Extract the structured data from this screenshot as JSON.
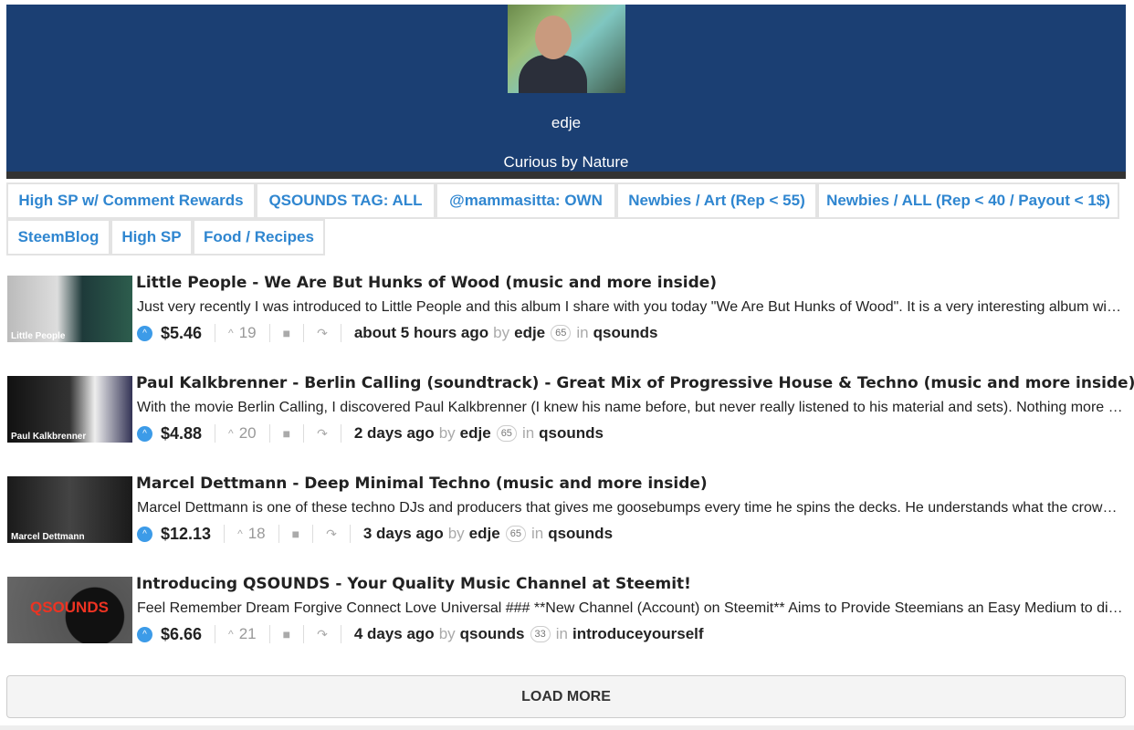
{
  "profile": {
    "name": "edje",
    "bio": "Curious by Nature"
  },
  "tabs": [
    "High SP w/ Comment Rewards",
    "QSOUNDS TAG: ALL",
    "@mammasitta: OWN",
    "Newbies / Art (Rep < 55)",
    "Newbies / ALL (Rep < 40 / Payout < 1$)",
    "SteemBlog",
    "High SP",
    "Food / Recipes"
  ],
  "posts": [
    {
      "thumb_text": "Little People",
      "title": "Little People - We Are But Hunks of Wood (music and more inside)",
      "body": "Just very recently I was introduced to Little People and this album I share with you today \"We Are But Hunks of Wood\". It is a very interesting album with a lot of variety.",
      "payout": "$5.46",
      "votes": "19",
      "time": "about 5 hours ago",
      "by": "by",
      "author": "edje",
      "rep": "65",
      "in": "in",
      "category": "qsounds"
    },
    {
      "thumb_text": "Paul Kalkbrenner",
      "title": "Paul Kalkbrenner - Berlin Calling (soundtrack) - Great Mix of Progressive House & Techno (music and more inside)",
      "body": "With the movie Berlin Calling, I discovered Paul Kalkbrenner (I knew his name before, but never really listened to his material and sets). Nothing more to say.",
      "payout": "$4.88",
      "votes": "20",
      "time": "2 days ago",
      "by": "by",
      "author": "edje",
      "rep": "65",
      "in": "in",
      "category": "qsounds"
    },
    {
      "thumb_text": "Marcel Dettmann",
      "title": "Marcel Dettmann - Deep Minimal Techno (music and more inside)",
      "body": "Marcel Dettmann is one of these techno DJs and producers that gives me goosebumps every time he spins the decks. He understands what the crowd wants.",
      "payout": "$12.13",
      "votes": "18",
      "time": "3 days ago",
      "by": "by",
      "author": "edje",
      "rep": "65",
      "in": "in",
      "category": "qsounds"
    },
    {
      "thumb_text": "QSOUNDS",
      "title": "Introducing QSOUNDS - Your Quality Music Channel at Steemit!",
      "body": "Feel Remember Dream Forgive Connect Love Universal ### **New Channel (Account) on Steemit** Aims to Provide Steemians an Easy Medium to discover music.",
      "payout": "$6.66",
      "votes": "21",
      "time": "4 days ago",
      "by": "by",
      "author": "qsounds",
      "rep": "33",
      "in": "in",
      "category": "introduceyourself"
    }
  ],
  "load_more": "LOAD MORE"
}
